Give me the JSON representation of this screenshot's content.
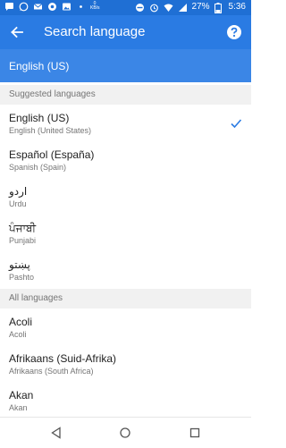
{
  "status_bar": {
    "icons": [
      "message-icon",
      "whatsapp-icon",
      "mail-icon",
      "chrome-icon",
      "photo-icon",
      "dot-icon"
    ],
    "network_speed": "0 KB/s",
    "battery_pct": "27%",
    "time": "5:36"
  },
  "app_bar": {
    "title": "Search language"
  },
  "current": {
    "value": "English (US)"
  },
  "sections": {
    "suggested": "Suggested languages",
    "all": "All languages"
  },
  "suggested_languages": [
    {
      "name": "English (US)",
      "sub": "English (United States)"
    },
    {
      "name": "Español (España)",
      "sub": "Spanish (Spain)"
    },
    {
      "name": "اردو",
      "sub": "Urdu"
    },
    {
      "name": "ਪੰਜਾਬੀ",
      "sub": "Punjabi"
    },
    {
      "name": "پښتو",
      "sub": "Pashto"
    }
  ],
  "all_languages": [
    {
      "name": "Acoli",
      "sub": "Acoli"
    },
    {
      "name": "Afrikaans (Suid-Afrika)",
      "sub": "Afrikaans (South Africa)"
    },
    {
      "name": "Akan",
      "sub": "Akan"
    }
  ],
  "colors": {
    "status_bar": "#1f6fd4",
    "app_bar": "#2a7be3",
    "current_box": "#3b86e6",
    "check": "#2a7be3"
  }
}
